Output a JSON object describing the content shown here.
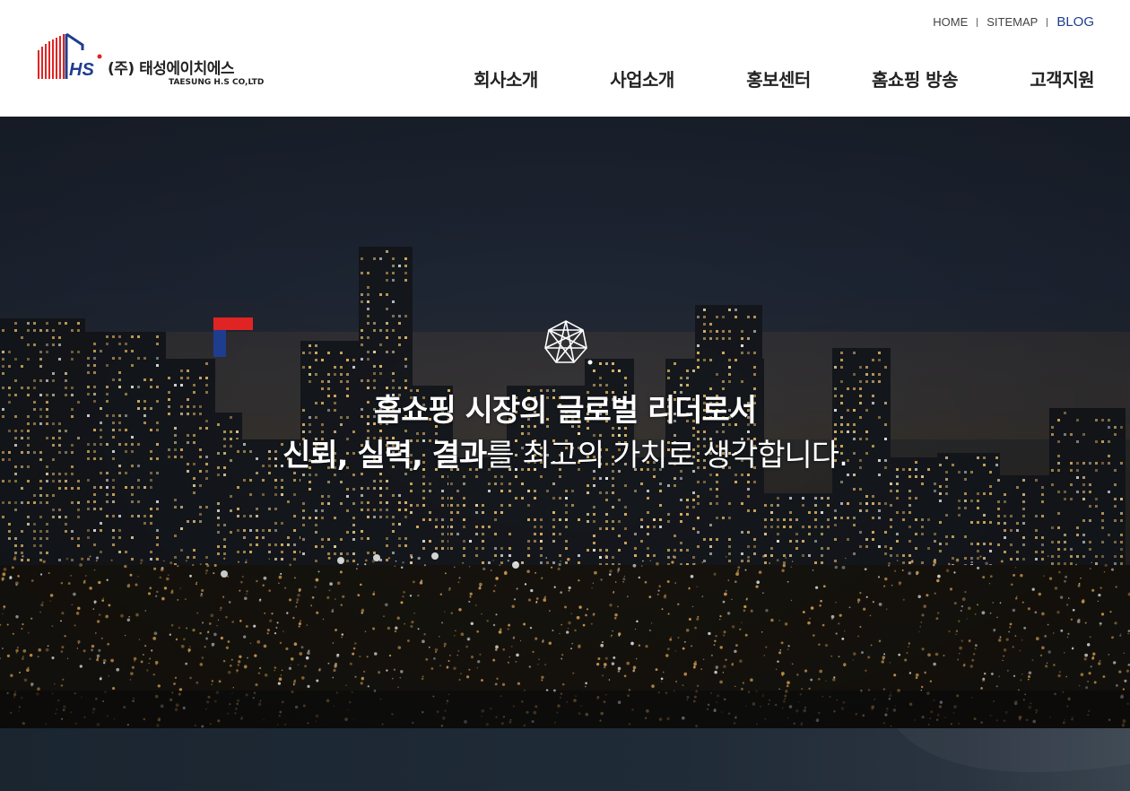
{
  "logo": {
    "mark_text": "HS",
    "company_kr": "(주) 태성에이치에스",
    "company_en": "TAESUNG H.S CO,LTD"
  },
  "util_links": [
    "HOME",
    "SITEMAP",
    "BLOG"
  ],
  "gnb": [
    "회사소개",
    "사업소개",
    "홍보센터",
    "홈쇼핑 방송",
    "고객지원"
  ],
  "hero": {
    "title": "홈쇼핑 시장의 글로벌 리더로서",
    "sub_bold": "신뢰, 실력, 결과",
    "sub_rest": "를 최고의 가치로 생각합니다."
  },
  "colors": {
    "brand_blue": "#1e3d8f",
    "brand_red": "#e02424",
    "header_bg": "#ffffff",
    "hero_text": "#ffffff"
  },
  "icons": {
    "logo": "hs-logo-icon",
    "network": "network-globe-icon",
    "corner": "corner-bracket-icon"
  }
}
